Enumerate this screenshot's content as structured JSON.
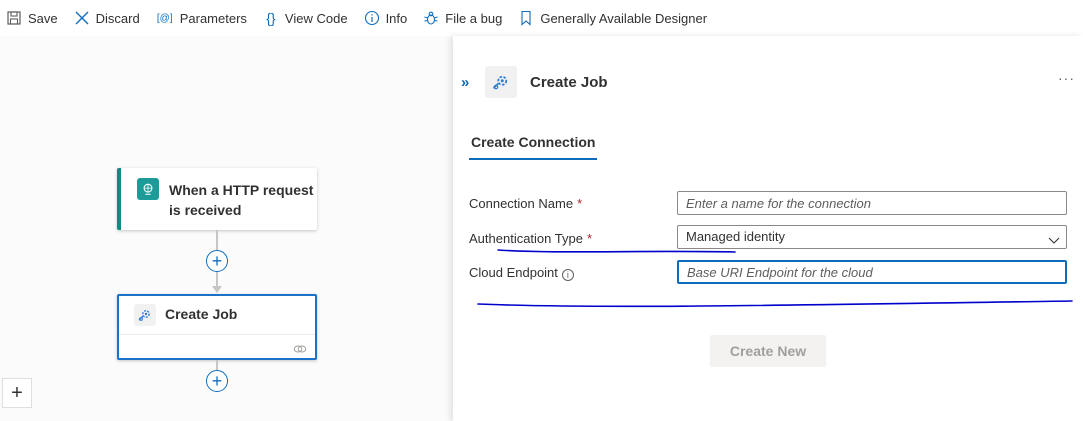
{
  "toolbar": {
    "items": [
      {
        "label": "Save",
        "icon": "save-icon"
      },
      {
        "label": "Discard",
        "icon": "close-icon"
      },
      {
        "label": "Parameters",
        "icon": "parameters-icon"
      },
      {
        "label": "View Code",
        "icon": "braces-icon"
      },
      {
        "label": "Info",
        "icon": "info-icon"
      },
      {
        "label": "File a bug",
        "icon": "bug-icon"
      },
      {
        "label": "Generally Available Designer",
        "icon": "bookmark-icon"
      }
    ]
  },
  "canvas": {
    "trigger": {
      "title": "When a HTTP request is received",
      "icon": "http-request-icon"
    },
    "action": {
      "title": "Create Job",
      "icon": "job-gear-icon"
    },
    "zoom_in": "+"
  },
  "panel": {
    "collapse": "»",
    "title": "Create Job",
    "more": "···",
    "tab": "Create Connection",
    "fields": {
      "connection_name": {
        "label": "Connection Name",
        "required": "*",
        "placeholder": "Enter a name for the connection",
        "value": ""
      },
      "auth_type": {
        "label": "Authentication Type",
        "required": "*",
        "value": "Managed identity"
      },
      "cloud_endpoint": {
        "label": "Cloud Endpoint",
        "info": "i",
        "placeholder": "Base URI Endpoint for the cloud",
        "value": ""
      }
    },
    "create_button": "Create New"
  },
  "colors": {
    "accent": "#0f6cbd",
    "trigger_bar": "#0e8c84",
    "annotation": "#0000cc"
  }
}
